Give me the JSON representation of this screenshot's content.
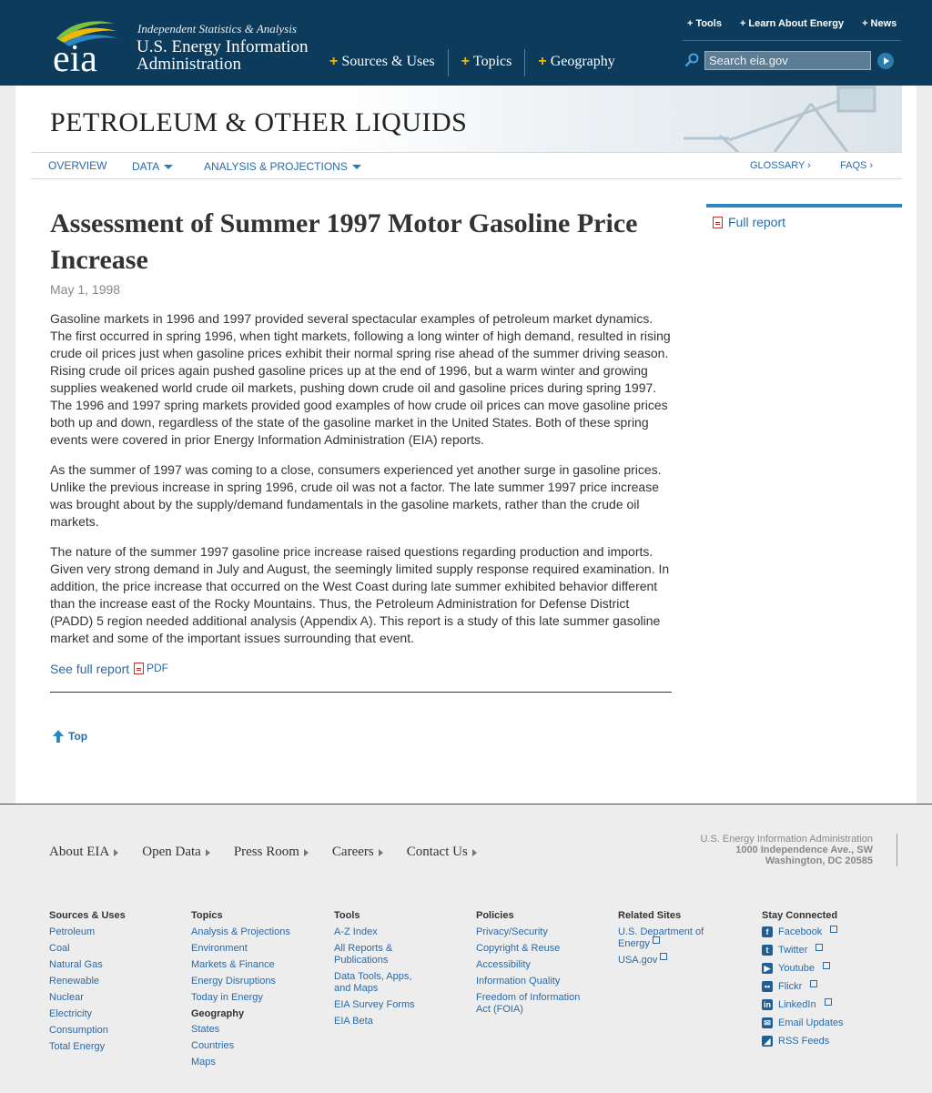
{
  "header": {
    "tagline": "Independent Statistics & Analysis",
    "agency_line1": "U.S. Energy Information",
    "agency_line2": "Administration",
    "logo_text": "eia",
    "main_nav": [
      "Sources & Uses",
      "Topics",
      "Geography"
    ],
    "util_nav": [
      "Tools",
      "Learn About Energy",
      "News"
    ],
    "search_placeholder": "Search eia.gov"
  },
  "section": {
    "title": "PETROLEUM & OTHER LIQUIDS",
    "subnav": {
      "overview": "OVERVIEW",
      "data": "DATA",
      "analysis": "ANALYSIS & PROJECTIONS",
      "glossary": "GLOSSARY ›",
      "faqs": "FAQS ›"
    }
  },
  "article": {
    "title": "Assessment of Summer 1997 Motor Gasoline Price Increase",
    "date": "May 1, 1998",
    "paragraphs": [
      "Gasoline markets in 1996 and 1997 provided several spectacular examples of petroleum market dynamics. The first occurred in spring 1996, when tight markets, following a long winter of high demand, resulted in rising crude oil prices just when gasoline prices exhibit their normal spring rise ahead of the summer driving season. Rising crude oil prices again pushed gasoline prices up at the end of 1996, but a warm winter and growing supplies weakened world crude oil markets, pushing down crude oil and gasoline prices during spring 1997. The 1996 and 1997 spring markets provided good examples of how crude oil prices can move gasoline prices both up and down, regardless of the state of the gasoline market in the United States. Both of these spring events were covered in prior Energy Information Administration (EIA) reports.",
      "As the summer of 1997 was coming to a close, consumers experienced yet another surge in gasoline prices. Unlike the previous increase in spring 1996, crude oil was not a factor. The late summer 1997 price increase was brought about by the supply/demand fundamentals in the gasoline markets, rather than the crude oil markets.",
      "The nature of the summer 1997 gasoline price increase raised questions regarding production and imports. Given very strong demand in July and August, the seemingly limited supply response required examination. In addition, the price increase that occurred on the West Coast during late summer exhibited behavior different than the increase east of the Rocky Mountains. Thus, the Petroleum Administration for Defense District (PADD) 5 region needed additional analysis (Appendix A). This report is a study of this late summer gasoline market and some of the important issues surrounding that event."
    ],
    "see_full_report": "See full report",
    "pdf_label": "PDF",
    "top_label": "Top"
  },
  "sidebar": {
    "full_report": "Full report"
  },
  "footer": {
    "nav": [
      "About EIA",
      "Open Data",
      "Press Room",
      "Careers",
      "Contact Us"
    ],
    "address": [
      "U.S. Energy Information Administration",
      "1000 Independence Ave., SW",
      "Washington, DC 20585"
    ],
    "columns": {
      "sources": {
        "heading": "Sources & Uses",
        "links": [
          "Petroleum",
          "Coal",
          "Natural Gas",
          "Renewable",
          "Nuclear",
          "Electricity",
          "Consumption",
          "Total Energy"
        ]
      },
      "topics": {
        "heading": "Topics",
        "links": [
          "Analysis & Projections",
          "Environment",
          "Markets & Finance",
          "Energy Disruptions",
          "Today in Energy"
        ],
        "subheading": "Geography",
        "sublinks": [
          "States",
          "Countries",
          "Maps"
        ]
      },
      "tools": {
        "heading": "Tools",
        "links": [
          "A-Z Index",
          "All Reports & Publications",
          "Data Tools, Apps, and Maps",
          "EIA Survey Forms",
          "EIA Beta"
        ]
      },
      "policies": {
        "heading": "Policies",
        "links": [
          "Privacy/Security",
          "Copyright & Reuse",
          "Accessibility",
          "Information Quality",
          "Freedom of Information Act (FOIA)"
        ]
      },
      "related": {
        "heading": "Related Sites",
        "links": [
          "U.S. Department of Energy",
          "USA.gov"
        ]
      },
      "connected": {
        "heading": "Stay Connected",
        "links": [
          "Facebook",
          "Twitter",
          "Youtube",
          "Flickr",
          "LinkedIn",
          "Email Updates",
          "RSS Feeds"
        ]
      }
    }
  },
  "colors": {
    "header_bg": "#0c3b5c",
    "link": "#2a6aa8",
    "accent_plus": "#f2b800",
    "sidebar_rule": "#2a86c4"
  }
}
